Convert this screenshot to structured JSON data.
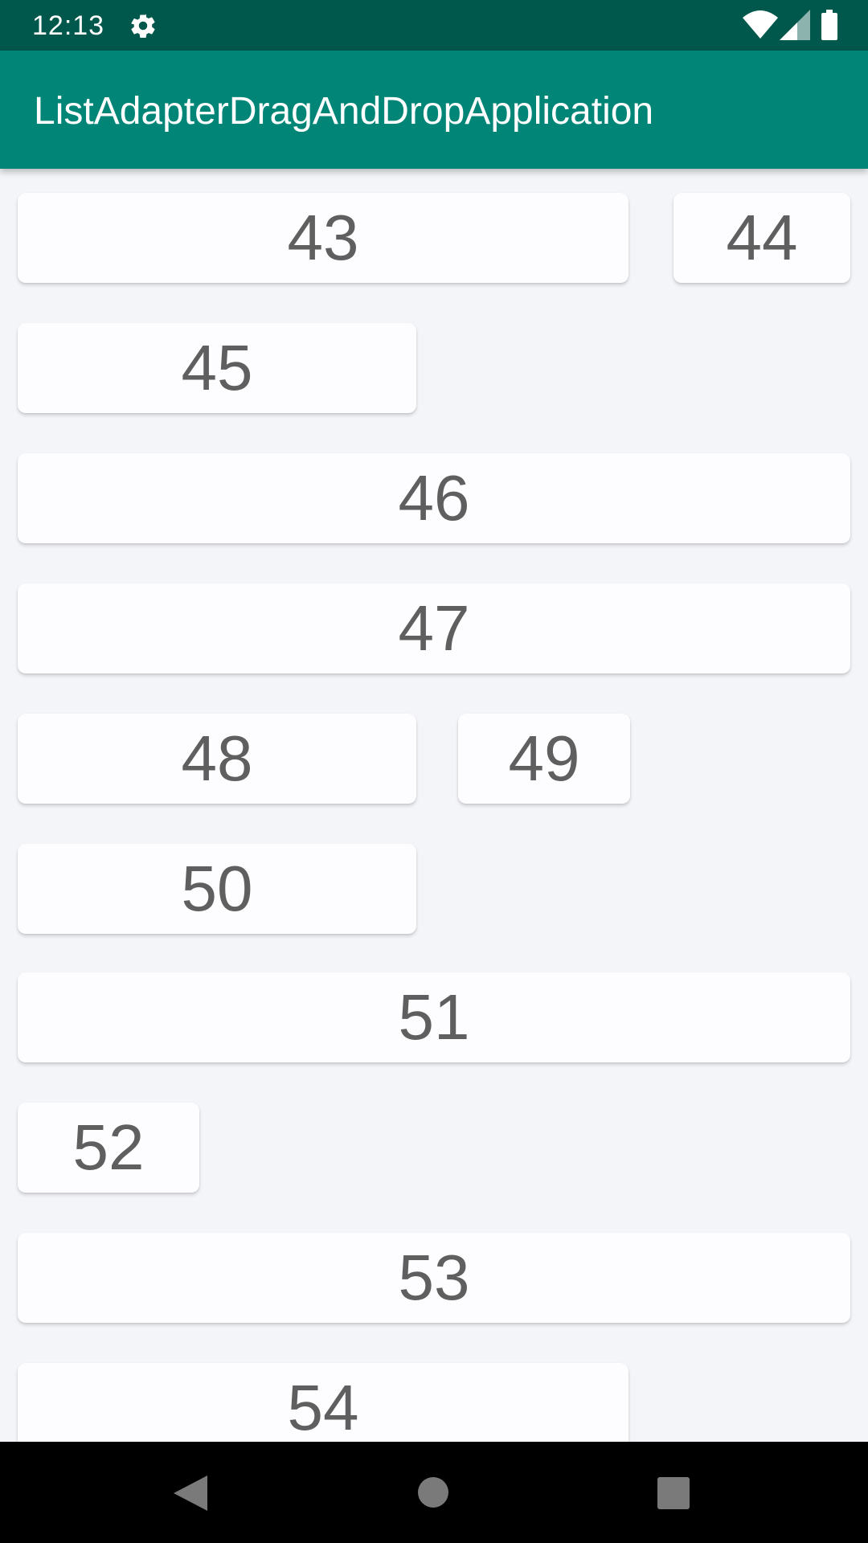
{
  "status_bar": {
    "time": "12:13",
    "icons": [
      "gear-icon",
      "wifi-icon",
      "cell-signal-icon",
      "battery-icon"
    ]
  },
  "app_bar": {
    "title": "ListAdapterDragAndDropApplication",
    "color": "#008577",
    "status_color": "#00574b"
  },
  "list": {
    "items": [
      {
        "label": "43"
      },
      {
        "label": "44"
      },
      {
        "label": "45"
      },
      {
        "label": "46"
      },
      {
        "label": "47"
      },
      {
        "label": "48"
      },
      {
        "label": "49"
      },
      {
        "label": "50"
      },
      {
        "label": "51"
      },
      {
        "label": "52"
      },
      {
        "label": "53"
      },
      {
        "label": "54"
      }
    ]
  },
  "nav_bar": {
    "icons": [
      "back-icon",
      "home-icon",
      "recents-icon"
    ]
  }
}
